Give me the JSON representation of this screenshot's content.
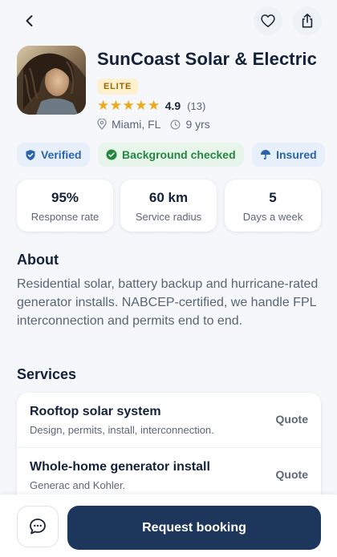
{
  "provider": {
    "name": "SunCoast Solar & Electric",
    "tier": "ELITE",
    "rating": "4.9",
    "review_count": "(13)",
    "location": "Miami, FL",
    "experience": "9 yrs"
  },
  "badges": [
    {
      "label": "Verified",
      "icon": "shield-check-icon"
    },
    {
      "label": "Background checked",
      "icon": "check-circle-icon"
    },
    {
      "label": "Insured",
      "icon": "umbrella-icon"
    }
  ],
  "stats": [
    {
      "value": "95%",
      "label": "Response rate"
    },
    {
      "value": "60 km",
      "label": "Service radius"
    },
    {
      "value": "5",
      "label": "Days a week"
    }
  ],
  "about": {
    "heading": "About",
    "text": "Residential solar, battery backup and hurricane-rated generator installs. NABCEP-certified, we handle FPL interconnection and permits end to end."
  },
  "services": {
    "heading": "Services",
    "items": [
      {
        "name": "Rooftop solar system",
        "desc": "Design, permits, install, interconnection.",
        "action": "Quote"
      },
      {
        "name": "Whole-home generator install",
        "desc": "Generac and Kohler.",
        "action": "Quote"
      }
    ]
  },
  "actions": {
    "book_label": "Request booking"
  },
  "colors": {
    "primary": "#1d365c",
    "star": "#f0a818",
    "verified": "#2b63ad",
    "background_checked": "#23873f",
    "elite_bg": "#fdf0cf"
  }
}
